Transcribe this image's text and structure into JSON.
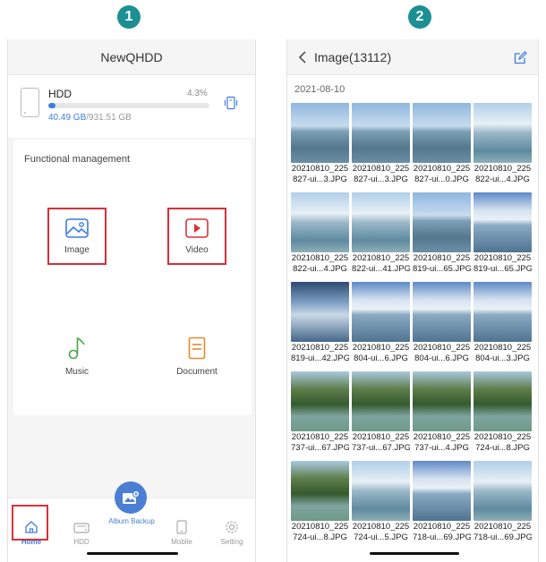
{
  "steps": [
    "1",
    "2"
  ],
  "home": {
    "title": "NewQHDD",
    "hdd": {
      "name": "HDD",
      "percent": "4.3%",
      "progress": 0.043,
      "used": "40.49 GB",
      "total": "/931.51 GB"
    },
    "functional_title": "Functional management",
    "functions": [
      {
        "label": "Image",
        "icon": "image-icon"
      },
      {
        "label": "Video",
        "icon": "video-icon"
      },
      {
        "label": "Music",
        "icon": "music-icon"
      },
      {
        "label": "Document",
        "icon": "document-icon"
      }
    ],
    "tabs": [
      {
        "label": "Home",
        "icon": "home-icon"
      },
      {
        "label": "HDD",
        "icon": "hdd-icon"
      },
      {
        "label": "Album Backup",
        "icon": "album-backup-icon"
      },
      {
        "label": "Mobile",
        "icon": "mobile-icon"
      },
      {
        "label": "Setting",
        "icon": "gear-icon"
      }
    ],
    "colors": {
      "accent": "#3c7de0",
      "highlight": "#d8303a",
      "album": "#4a7fd4",
      "badge": "#1b8f94"
    }
  },
  "gallery": {
    "title": "Image(13112)",
    "date": "2021-08-10",
    "items": [
      {
        "line1": "20210810_225",
        "line2": "827-ui...3.JPG",
        "style": "lake"
      },
      {
        "line1": "20210810_225",
        "line2": "827-ui...3.JPG",
        "style": "lake"
      },
      {
        "line1": "20210810_225",
        "line2": "827-ui...0.JPG",
        "style": "lake"
      },
      {
        "line1": "20210810_225",
        "line2": "822-ui...4.JPG",
        "style": "shore"
      },
      {
        "line1": "20210810_225",
        "line2": "822-ui...4.JPG",
        "style": "shore"
      },
      {
        "line1": "20210810_225",
        "line2": "822-ui...41.JPG",
        "style": "shore"
      },
      {
        "line1": "20210810_225",
        "line2": "819-ui...65.JPG",
        "style": "lake"
      },
      {
        "line1": "20210810_225",
        "line2": "819-ui...65.JPG",
        "style": "cloudy"
      },
      {
        "line1": "20210810_225",
        "line2": "819-ui...42.JPG",
        "style": "dark"
      },
      {
        "line1": "20210810_225",
        "line2": "804-ui...6.JPG",
        "style": "cloudy"
      },
      {
        "line1": "20210810_225",
        "line2": "804-ui...6.JPG",
        "style": "cloudy"
      },
      {
        "line1": "20210810_225",
        "line2": "804-ui...3.JPG",
        "style": "cloudy"
      },
      {
        "line1": "20210810_225",
        "line2": "737-ui...67.JPG",
        "style": "trees"
      },
      {
        "line1": "20210810_225",
        "line2": "737-ui...67.JPG",
        "style": "trees"
      },
      {
        "line1": "20210810_225",
        "line2": "737-ui...4.JPG",
        "style": "trees"
      },
      {
        "line1": "20210810_225",
        "line2": "724-ui...8.JPG",
        "style": "trees"
      },
      {
        "line1": "20210810_225",
        "line2": "724-ui...8.JPG",
        "style": "trees"
      },
      {
        "line1": "20210810_225",
        "line2": "724-ui...5.JPG",
        "style": "shore"
      },
      {
        "line1": "20210810_225",
        "line2": "718-ui...69.JPG",
        "style": "cloudy"
      },
      {
        "line1": "20210810_225",
        "line2": "718-ui...69.JPG",
        "style": "shore"
      }
    ]
  }
}
